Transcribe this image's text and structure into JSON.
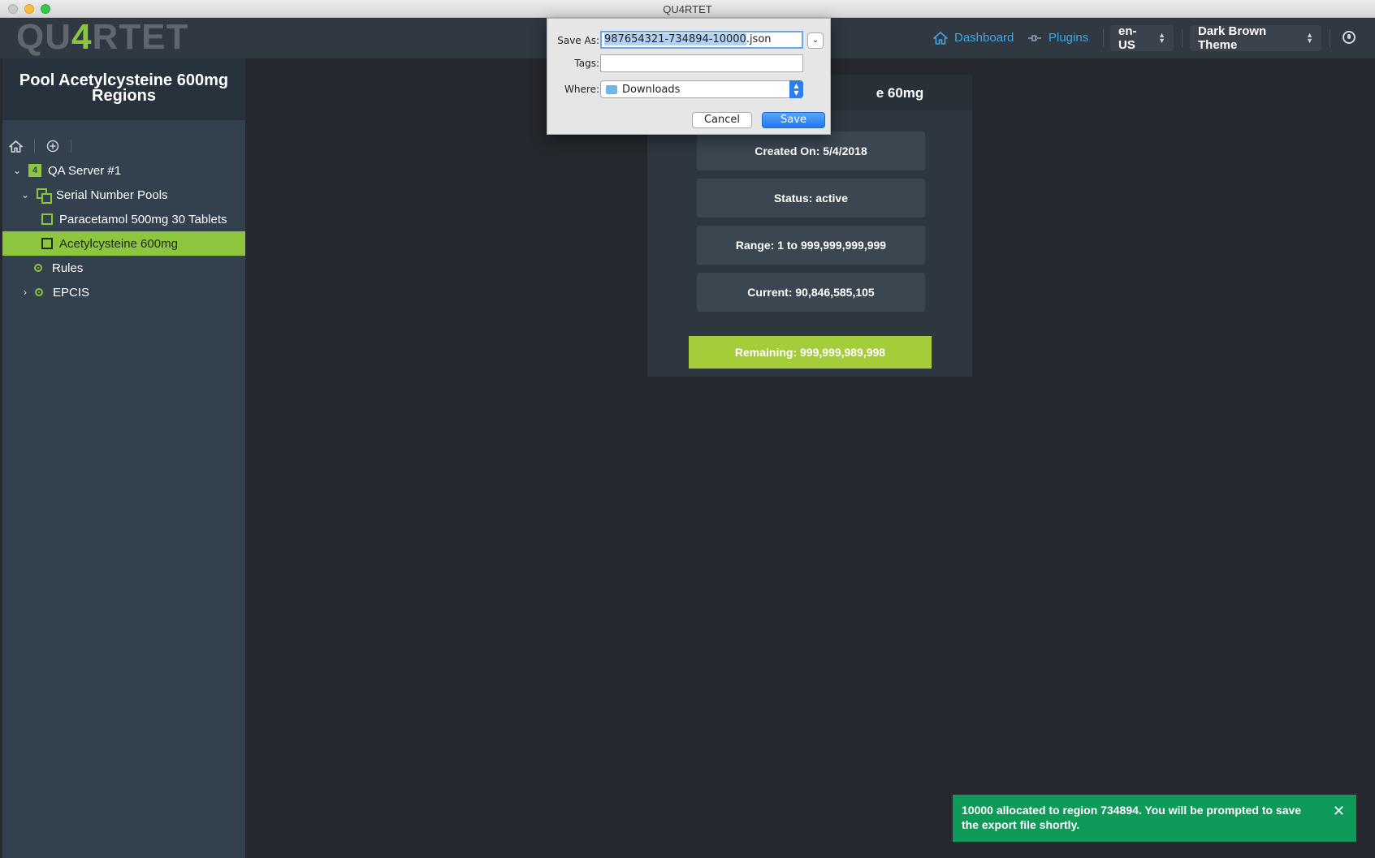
{
  "window": {
    "title": "QU4RTET"
  },
  "appbar": {
    "logo_pre": "QU",
    "logo_four": "4",
    "logo_post": "RTET",
    "dashboard_label": "Dashboard",
    "plugins_label": "Plugins",
    "language": "en-US",
    "theme": "Dark Brown Theme"
  },
  "sidebar": {
    "title": "Pool Acetylcysteine 600mg Regions",
    "tree": {
      "server": "QA Server #1",
      "pools_label": "Serial Number Pools",
      "pool_1": "Paracetamol 500mg 30 Tablets",
      "pool_2": "Acetylcysteine 600mg",
      "rules": "Rules",
      "epcis": "EPCIS"
    }
  },
  "card": {
    "title_visible": "e 60mg",
    "created": "Created On: 5/4/2018",
    "status": "Status: active",
    "range": "Range: 1 to 999,999,999,999",
    "current": "Current: 90,846,585,105",
    "remaining": "Remaining: 999,999,989,998"
  },
  "save_dialog": {
    "save_as_label": "Save As:",
    "filename_selected": "987654321-734894-10000",
    "filename_ext": ".json",
    "tags_label": "Tags:",
    "tags_value": "",
    "where_label": "Where:",
    "where_value": "Downloads",
    "cancel_label": "Cancel",
    "save_label": "Save"
  },
  "toast": {
    "message": "10000 allocated to region 734894. You will be prompted to save the export file shortly.",
    "close_glyph": "✕",
    "color": "#109a5a"
  },
  "colors": {
    "accent": "#8cc63f",
    "link": "#3ea8e5",
    "remaining": "#a5cd39"
  }
}
